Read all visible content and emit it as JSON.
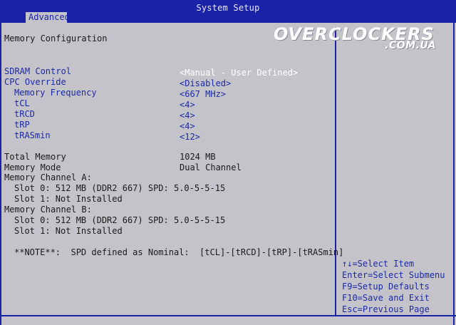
{
  "window": {
    "title": "System Setup",
    "active_tab": "Advanced"
  },
  "page": {
    "heading": "Memory Configuration"
  },
  "watermark": {
    "main": "OVERCLOCKERS",
    "sub": ".COM.UA"
  },
  "settings": [
    {
      "label": "SDRAM Control",
      "value": "<Manual - User Defined>"
    },
    {
      "label": "CPC Override",
      "value": "<Disabled>"
    },
    {
      "label": "Memory Frequency",
      "value": "<667 MHz>"
    },
    {
      "label": "tCL",
      "value": "<4>"
    },
    {
      "label": "tRCD",
      "value": "<4>"
    },
    {
      "label": "tRP",
      "value": "<4>"
    },
    {
      "label": "tRASmin",
      "value": "<12>"
    }
  ],
  "info": {
    "total_memory_label": "Total Memory",
    "total_memory_value": "1024 MB",
    "memory_mode_label": "Memory Mode",
    "memory_mode_value": "Dual Channel",
    "channel_a_label": "Memory Channel A:",
    "channel_a_slot0": "Slot 0: 512 MB (DDR2 667) SPD: 5.0-5-5-15",
    "channel_a_slot1": "Slot 1: Not Installed",
    "channel_b_label": "Memory Channel B:",
    "channel_b_slot0": "Slot 0: 512 MB (DDR2 667) SPD: 5.0-5-5-15",
    "channel_b_slot1": "Slot 1: Not Installed"
  },
  "note": "**NOTE**:  SPD defined as Nominal:  [tCL]-[tRCD]-[tRP]-[tRASmin]",
  "help": [
    "↑↓=Select Item",
    "Enter=Select Submenu",
    "F9=Setup Defaults",
    "F10=Save and Exit",
    "Esc=Previous Page"
  ],
  "colors": {
    "bar": "#1a22a8",
    "background": "#c4c3c9",
    "highlight": "#ffffff",
    "accent": "#1c2aa6"
  }
}
